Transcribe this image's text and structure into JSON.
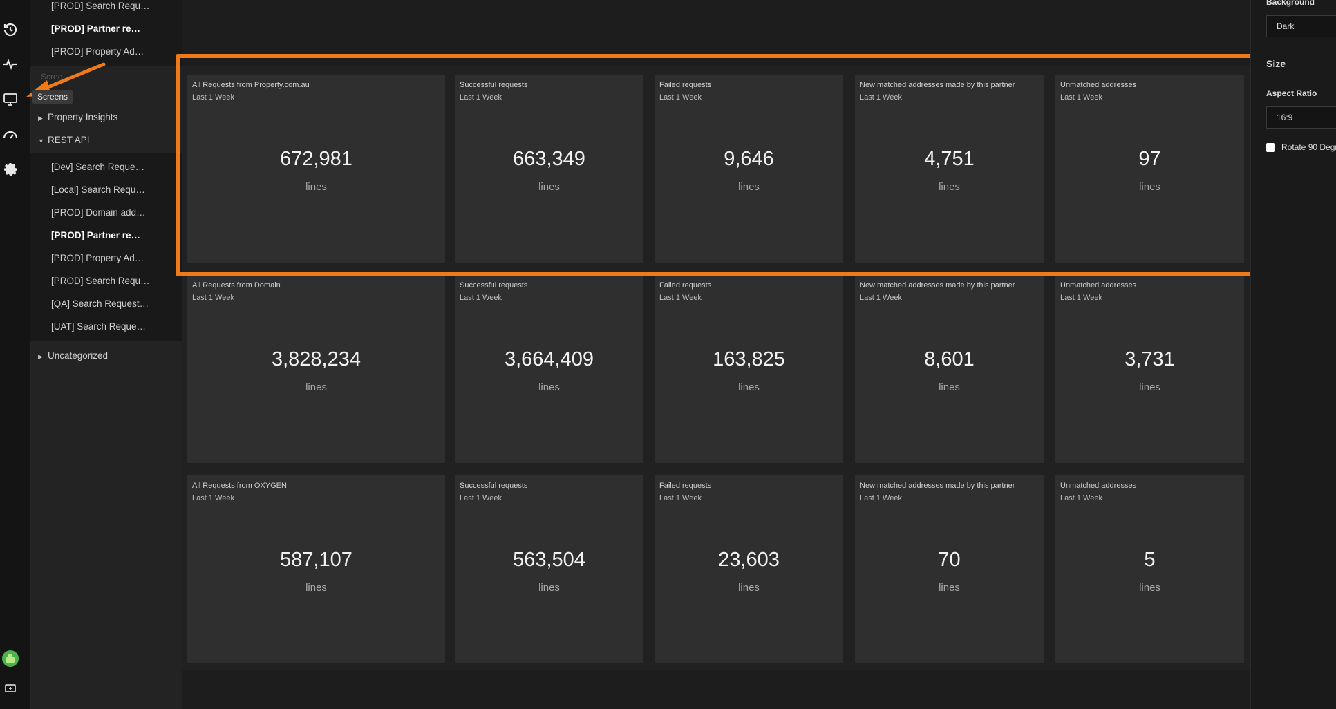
{
  "rail": {
    "tooltip": "Screens",
    "icons": [
      "history-icon",
      "pulse-icon",
      "screens-icon",
      "dashboard-icon",
      "settings-icon",
      "avatar",
      "display-icon"
    ]
  },
  "sidebar": {
    "top_items": [
      "[PROD] Search Requ…",
      "[PROD] Partner re…",
      "[PROD] Property Ad…"
    ],
    "faint_label": "Scree",
    "folders": {
      "property_insights": "Property Insights",
      "rest_api": "REST API",
      "uncategorized": "Uncategorized"
    },
    "rest_items": [
      "[Dev] Search Reque…",
      "[Local] Search Requ…",
      "[PROD] Domain add…",
      "[PROD] Partner re…",
      "[PROD] Property Ad…",
      "[PROD] Search Requ…",
      "[QA] Search Request…",
      "[UAT] Search Reque…"
    ]
  },
  "rows": [
    {
      "cards": [
        {
          "title": "All Requests from Property.com.au",
          "period": "Last 1 Week",
          "value": "672,981",
          "unit": "lines"
        },
        {
          "title": "Successful requests",
          "period": "Last 1 Week",
          "value": "663,349",
          "unit": "lines"
        },
        {
          "title": "Failed requests",
          "period": "Last 1 Week",
          "value": "9,646",
          "unit": "lines"
        },
        {
          "title": "New matched addresses made by this partner",
          "period": "Last 1 Week",
          "value": "4,751",
          "unit": "lines"
        },
        {
          "title": "Unmatched addresses",
          "period": "Last 1 Week",
          "value": "97",
          "unit": "lines"
        }
      ]
    },
    {
      "cards": [
        {
          "title": "All Requests from Domain",
          "period": "Last 1 Week",
          "value": "3,828,234",
          "unit": "lines"
        },
        {
          "title": "Successful requests",
          "period": "Last 1 Week",
          "value": "3,664,409",
          "unit": "lines"
        },
        {
          "title": "Failed requests",
          "period": "Last 1 Week",
          "value": "163,825",
          "unit": "lines"
        },
        {
          "title": "New matched addresses made by this partner",
          "period": "Last 1 Week",
          "value": "8,601",
          "unit": "lines"
        },
        {
          "title": "Unmatched addresses",
          "period": "Last 1 Week",
          "value": "3,731",
          "unit": "lines"
        }
      ]
    },
    {
      "cards": [
        {
          "title": "All Requests from OXYGEN",
          "period": "Last 1 Week",
          "value": "587,107",
          "unit": "lines"
        },
        {
          "title": "Successful requests",
          "period": "Last 1 Week",
          "value": "563,504",
          "unit": "lines"
        },
        {
          "title": "Failed requests",
          "period": "Last 1 Week",
          "value": "23,603",
          "unit": "lines"
        },
        {
          "title": "New matched addresses made by this partner",
          "period": "Last 1 Week",
          "value": "70",
          "unit": "lines"
        },
        {
          "title": "Unmatched addresses",
          "period": "Last 1 Week",
          "value": "5",
          "unit": "lines"
        }
      ]
    }
  ],
  "right_panel": {
    "background_label": "Background",
    "background_value": "Dark",
    "size_label": "Size",
    "aspect_label": "Aspect Ratio",
    "aspect_value": "16:9",
    "rotate_label": "Rotate 90 Degr"
  },
  "colors": {
    "highlight": "#f07a1a",
    "active_accent": "#8a6bff",
    "avatar": "#4caf50"
  }
}
